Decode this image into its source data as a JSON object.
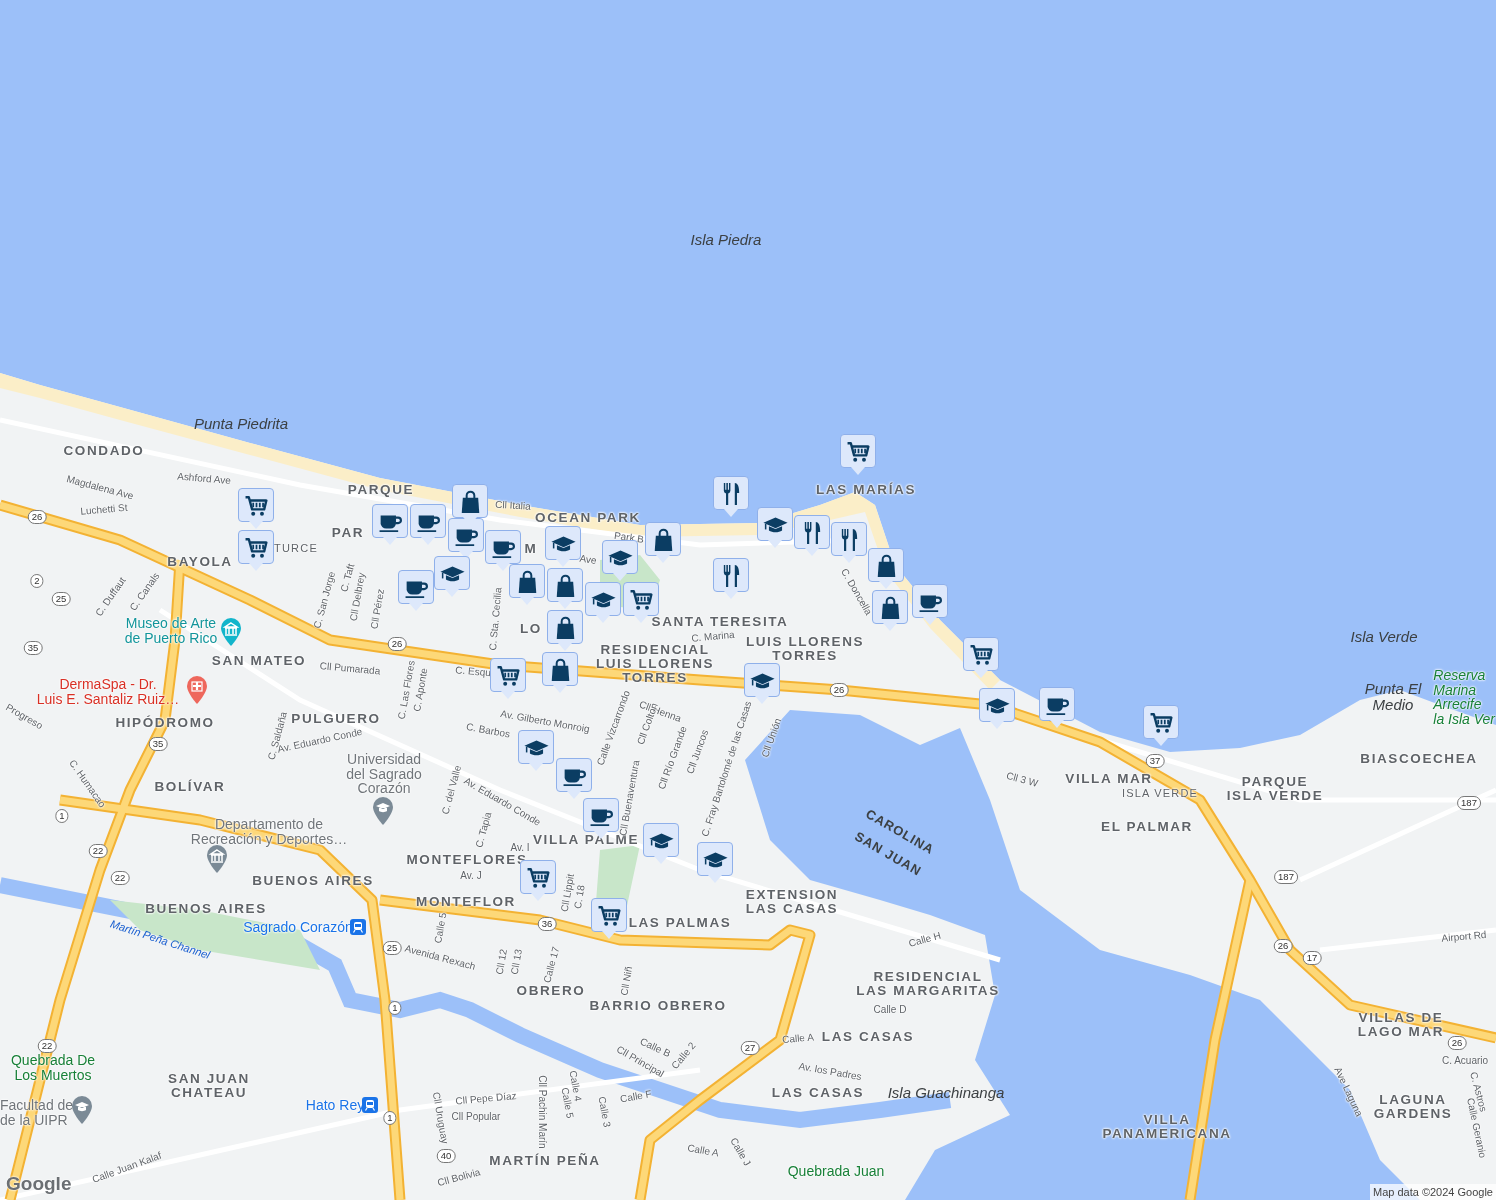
{
  "map": {
    "labels": [
      {
        "kind": "water",
        "text": "Isla Piedra"
      },
      {
        "kind": "water",
        "text": "Punta Piedrita"
      },
      {
        "kind": "water",
        "text": "Isla Verde"
      },
      {
        "kind": "water",
        "lines": [
          "Punta El",
          "Medio"
        ]
      },
      {
        "kind": "water",
        "text": "Isla Guachinanga"
      },
      {
        "kind": "boundary",
        "text": "CAROLINA"
      },
      {
        "kind": "boundary",
        "text": "SAN JUAN"
      },
      {
        "kind": "area",
        "text": "CONDADO"
      },
      {
        "kind": "area",
        "text": "PARQUE"
      },
      {
        "kind": "area",
        "text": "PAR"
      },
      {
        "kind": "area",
        "text": "BAYOLA"
      },
      {
        "kind": "area-small",
        "text": "TURCE"
      },
      {
        "kind": "area",
        "text": "OCEAN PARK"
      },
      {
        "kind": "area",
        "text": "M"
      },
      {
        "kind": "area",
        "text": "LO"
      },
      {
        "kind": "area",
        "text": "SANTA TERESITA"
      },
      {
        "kind": "area",
        "lines": [
          "LUIS LLORENS",
          "TORRES"
        ]
      },
      {
        "kind": "area",
        "lines": [
          "RESIDENCIAL",
          "LUIS LLORENS",
          "TORRES"
        ]
      },
      {
        "kind": "area",
        "text": "LAS MARÍAS"
      },
      {
        "kind": "area",
        "text": "SAN MATEO"
      },
      {
        "kind": "area",
        "text": "HIPÓDROMO"
      },
      {
        "kind": "area",
        "text": "PULGUERO"
      },
      {
        "kind": "area",
        "text": "BOLÍVAR"
      },
      {
        "kind": "area",
        "text": "MONTEFLORES"
      },
      {
        "kind": "area",
        "text": "MONTEFLOR"
      },
      {
        "kind": "area",
        "text": "VILLA PALME"
      },
      {
        "kind": "area",
        "text": "BUENOS AIRES"
      },
      {
        "kind": "area",
        "text": "BUENOS AIRES"
      },
      {
        "kind": "area",
        "text": "LAS PALMAS"
      },
      {
        "kind": "area",
        "lines": [
          "EXTENSION",
          "LAS CASAS"
        ]
      },
      {
        "kind": "area",
        "text": "OBRERO"
      },
      {
        "kind": "area",
        "text": "BARRIO OBRERO"
      },
      {
        "kind": "area",
        "lines": [
          "RESIDENCIAL",
          "LAS MARGARITAS"
        ]
      },
      {
        "kind": "area",
        "text": "LAS CASAS"
      },
      {
        "kind": "area",
        "lines": [
          "SAN JUAN",
          "CHATEAU"
        ]
      },
      {
        "kind": "area",
        "text": "LAS CASAS"
      },
      {
        "kind": "area",
        "text": "MARTÍN PEÑA"
      },
      {
        "kind": "area",
        "text": "VILLA MAR"
      },
      {
        "kind": "area-small",
        "text": "ISLA VERDE"
      },
      {
        "kind": "area",
        "lines": [
          "PARQUE",
          "ISLA VERDE"
        ]
      },
      {
        "kind": "area",
        "text": "BIASCOECHEA"
      },
      {
        "kind": "area",
        "text": "EL PALMAR"
      },
      {
        "kind": "area",
        "lines": [
          "VILLAS DE",
          "LAGO MAR"
        ]
      },
      {
        "kind": "area",
        "lines": [
          "LAGUNA",
          "GARDENS"
        ]
      },
      {
        "kind": "area",
        "lines": [
          "VILLA",
          "PANAMERICANA"
        ]
      },
      {
        "kind": "museum",
        "lines": [
          "Museo de Arte",
          "de Puerto Rico"
        ]
      },
      {
        "kind": "health",
        "lines": [
          "DermaSpa - Dr.",
          "Luis E. Santaliz Ruiz…"
        ]
      },
      {
        "kind": "school",
        "lines": [
          "Universidad",
          "del Sagrado",
          "Corazón"
        ]
      },
      {
        "kind": "civic",
        "lines": [
          "Departamento de",
          "Recreación y Deportes…"
        ]
      },
      {
        "kind": "transit",
        "text": "Sagrado Corazón"
      },
      {
        "kind": "transit",
        "text": "Hato Rey"
      },
      {
        "kind": "park",
        "lines": [
          "Quebrada De",
          "Los Muertos"
        ]
      },
      {
        "kind": "school",
        "lines": [
          "Facultad de",
          "de la UIPR"
        ]
      },
      {
        "kind": "reserve",
        "lines": [
          "Reserva",
          "Marina",
          "Arrecife",
          "la Isla Ver"
        ]
      },
      {
        "kind": "park",
        "text": "Quebrada Juan"
      },
      {
        "kind": "street",
        "text": "Ashford Ave"
      },
      {
        "kind": "street",
        "text": "Magdalena Ave"
      },
      {
        "kind": "street",
        "text": "Luchetti St"
      },
      {
        "kind": "street",
        "text": "Cll Italia"
      },
      {
        "kind": "street",
        "text": "Park B"
      },
      {
        "kind": "street",
        "text": "Ave"
      },
      {
        "kind": "street",
        "text": "C. San Jorge"
      },
      {
        "kind": "street",
        "text": "C. Taft"
      },
      {
        "kind": "street",
        "text": "Cll Delbrey"
      },
      {
        "kind": "street",
        "text": "Cll Pérez"
      },
      {
        "kind": "street",
        "text": "C. Sta. Cecilia"
      },
      {
        "kind": "street",
        "text": "C. Duffaut"
      },
      {
        "kind": "street",
        "text": "C. Canals"
      },
      {
        "kind": "street",
        "text": "Cll Pumarada"
      },
      {
        "kind": "street",
        "text": "C. Esqu"
      },
      {
        "kind": "street",
        "text": "C. Las Flores"
      },
      {
        "kind": "street",
        "text": "C. Aponte"
      },
      {
        "kind": "street",
        "text": "C. Marina"
      },
      {
        "kind": "street",
        "text": "C. Doncella"
      },
      {
        "kind": "street",
        "text": "Av. Gilberto Monroig"
      },
      {
        "kind": "street",
        "text": "C. Barbos"
      },
      {
        "kind": "street",
        "text": "Cll Henna"
      },
      {
        "kind": "street",
        "text": "Calle Vizcarrondo"
      },
      {
        "kind": "street",
        "text": "Cll Colton"
      },
      {
        "kind": "street",
        "text": "Cll Río Grande"
      },
      {
        "kind": "street",
        "text": "Cll Juncos"
      },
      {
        "kind": "street",
        "text": "Cll Unión"
      },
      {
        "kind": "street",
        "text": "Av. Eduardo Conde"
      },
      {
        "kind": "street",
        "text": "Av. Eduardo Conde"
      },
      {
        "kind": "street",
        "text": "C. Saldaña"
      },
      {
        "kind": "street",
        "text": "Progreso"
      },
      {
        "kind": "street",
        "text": "C. Humacao"
      },
      {
        "kind": "street",
        "text": "C. del Valle"
      },
      {
        "kind": "street",
        "text": "C. Tapia"
      },
      {
        "kind": "street",
        "text": "Av. I"
      },
      {
        "kind": "street",
        "text": "Cll Buenaventura"
      },
      {
        "kind": "street",
        "text": "C. Fray Bartolomé de las Casas"
      },
      {
        "kind": "street",
        "text": "Av. J"
      },
      {
        "kind": "street",
        "text": "Cll Lippit"
      },
      {
        "kind": "street",
        "text": "C. 18"
      },
      {
        "kind": "street",
        "text": "Avenida Rexach"
      },
      {
        "kind": "channel",
        "text": "Martín Peña Channel"
      },
      {
        "kind": "street",
        "text": "Calle H"
      },
      {
        "kind": "street",
        "text": "Calle D"
      },
      {
        "kind": "street",
        "text": "Calle A"
      },
      {
        "kind": "street",
        "text": "Av. los Padres"
      },
      {
        "kind": "street",
        "text": "Cll Principal"
      },
      {
        "kind": "street",
        "text": "Calle 2"
      },
      {
        "kind": "street",
        "text": "Calle B"
      },
      {
        "kind": "street",
        "text": "Cll Pepe Díaz"
      },
      {
        "kind": "street",
        "text": "Cll Popular"
      },
      {
        "kind": "street",
        "text": "Cll Uruguay"
      },
      {
        "kind": "street",
        "text": "Cll Pachin Marín"
      },
      {
        "kind": "street",
        "text": "Calle 4"
      },
      {
        "kind": "street",
        "text": "Calle 5"
      },
      {
        "kind": "street",
        "text": "Calle 3"
      },
      {
        "kind": "street",
        "text": "Calle F"
      },
      {
        "kind": "street",
        "text": "Calle A"
      },
      {
        "kind": "street",
        "text": "Calle J"
      },
      {
        "kind": "street",
        "text": "Cll Bolivia"
      },
      {
        "kind": "street",
        "text": "Calle Juan Kalaf"
      },
      {
        "kind": "street",
        "text": "Cll 3 W"
      },
      {
        "kind": "street",
        "text": "Airport Rd"
      },
      {
        "kind": "street",
        "text": "C. Acuario"
      },
      {
        "kind": "street",
        "text": "Ave Laguna"
      },
      {
        "kind": "street",
        "text": "Calle Geranio"
      },
      {
        "kind": "street",
        "text": "C. Astros"
      },
      {
        "kind": "street",
        "text": "Cll Niñ"
      },
      {
        "kind": "street",
        "text": "Calle 5"
      },
      {
        "kind": "street",
        "text": "Cll 12"
      },
      {
        "kind": "street",
        "text": "Cll 13"
      },
      {
        "kind": "street",
        "text": "Calle 17"
      }
    ],
    "route_shields": [
      "26",
      "2",
      "25",
      "35",
      "26",
      "35",
      "26",
      "1",
      "22",
      "22",
      "36",
      "25",
      "1",
      "22",
      "1",
      "40",
      "27",
      "37",
      "187",
      "187",
      "26",
      "17",
      "26"
    ],
    "markers": [
      {
        "kind": "cart"
      },
      {
        "kind": "restaurant"
      },
      {
        "kind": "cart"
      },
      {
        "kind": "cart"
      },
      {
        "kind": "coffee"
      },
      {
        "kind": "coffee"
      },
      {
        "kind": "coffee"
      },
      {
        "kind": "bag"
      },
      {
        "kind": "coffee"
      },
      {
        "kind": "school"
      },
      {
        "kind": "bag"
      },
      {
        "kind": "school"
      },
      {
        "kind": "coffee"
      },
      {
        "kind": "bag"
      },
      {
        "kind": "bag"
      },
      {
        "kind": "school"
      },
      {
        "kind": "school"
      },
      {
        "kind": "cart"
      },
      {
        "kind": "bag"
      },
      {
        "kind": "bag"
      },
      {
        "kind": "restaurant"
      },
      {
        "kind": "school"
      },
      {
        "kind": "restaurant"
      },
      {
        "kind": "restaurant"
      },
      {
        "kind": "bag"
      },
      {
        "kind": "bag"
      },
      {
        "kind": "coffee"
      },
      {
        "kind": "cart"
      },
      {
        "kind": "school"
      },
      {
        "kind": "coffee"
      },
      {
        "kind": "cart"
      },
      {
        "kind": "school"
      },
      {
        "kind": "cart"
      },
      {
        "kind": "school"
      },
      {
        "kind": "coffee"
      },
      {
        "kind": "coffee"
      },
      {
        "kind": "school"
      },
      {
        "kind": "school"
      },
      {
        "kind": "cart"
      },
      {
        "kind": "cart"
      }
    ],
    "logo": "Google",
    "attribution": "Map data ©2024 Google"
  }
}
